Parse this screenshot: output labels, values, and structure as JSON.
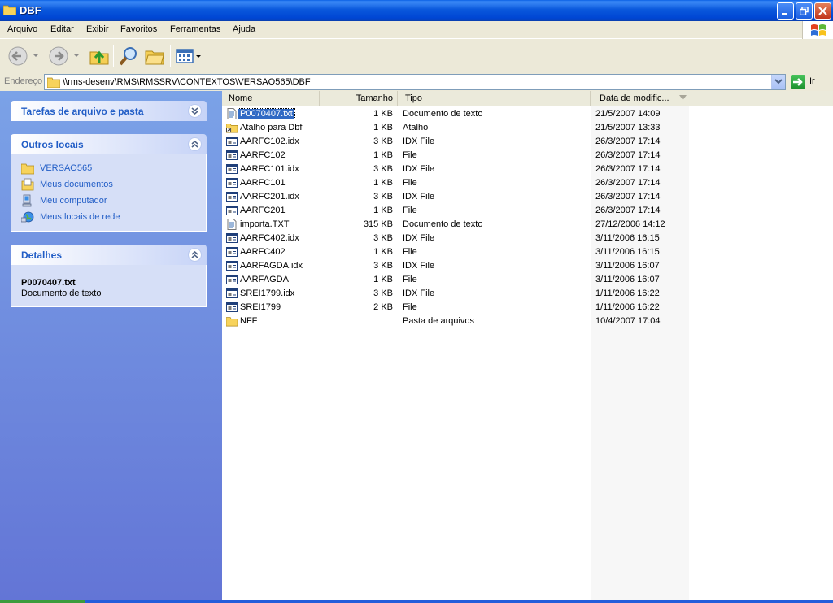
{
  "window": {
    "title": "DBF"
  },
  "menu": [
    "Arquivo",
    "Editar",
    "Exibir",
    "Favoritos",
    "Ferramentas",
    "Ajuda"
  ],
  "address": {
    "label": "Endereço",
    "path": "\\\\rms-desenv\\RMS\\RMSSRV\\CONTEXTOS\\VERSAO565\\DBF",
    "go_label": "Ir"
  },
  "taskpane": {
    "tasks_title": "Tarefas de arquivo e pasta",
    "places_title": "Outros locais",
    "places": [
      {
        "label": "VERSAO565",
        "icon": "folder-icon"
      },
      {
        "label": "Meus documentos",
        "icon": "my-documents-icon"
      },
      {
        "label": "Meu computador",
        "icon": "my-computer-icon"
      },
      {
        "label": "Meus locais de rede",
        "icon": "network-places-icon"
      }
    ],
    "details_title": "Detalhes",
    "details_name": "P0070407.txt",
    "details_type": "Documento de texto"
  },
  "columns": {
    "name": "Nome",
    "size": "Tamanho",
    "type": "Tipo",
    "date": "Data de modific..."
  },
  "files": [
    {
      "name": "P0070407.txt",
      "size": "1 KB",
      "type": "Documento de texto",
      "date": "21/5/2007 14:09",
      "icon": "text-file-icon",
      "selected": true
    },
    {
      "name": "Atalho para Dbf",
      "size": "1 KB",
      "type": "Atalho",
      "date": "21/5/2007 13:33",
      "icon": "shortcut-folder-icon"
    },
    {
      "name": "AARFC102.idx",
      "size": "3 KB",
      "type": "IDX File",
      "date": "26/3/2007 17:14",
      "icon": "file-icon"
    },
    {
      "name": "AARFC102",
      "size": "1 KB",
      "type": "File",
      "date": "26/3/2007 17:14",
      "icon": "file-icon"
    },
    {
      "name": "AARFC101.idx",
      "size": "3 KB",
      "type": "IDX File",
      "date": "26/3/2007 17:14",
      "icon": "file-icon"
    },
    {
      "name": "AARFC101",
      "size": "1 KB",
      "type": "File",
      "date": "26/3/2007 17:14",
      "icon": "file-icon"
    },
    {
      "name": "AARFC201.idx",
      "size": "3 KB",
      "type": "IDX File",
      "date": "26/3/2007 17:14",
      "icon": "file-icon"
    },
    {
      "name": "AARFC201",
      "size": "1 KB",
      "type": "File",
      "date": "26/3/2007 17:14",
      "icon": "file-icon"
    },
    {
      "name": "importa.TXT",
      "size": "315 KB",
      "type": "Documento de texto",
      "date": "27/12/2006 14:12",
      "icon": "text-file-icon"
    },
    {
      "name": "AARFC402.idx",
      "size": "3 KB",
      "type": "IDX File",
      "date": "3/11/2006 16:15",
      "icon": "file-icon"
    },
    {
      "name": "AARFC402",
      "size": "1 KB",
      "type": "File",
      "date": "3/11/2006 16:15",
      "icon": "file-icon"
    },
    {
      "name": "AARFAGDA.idx",
      "size": "3 KB",
      "type": "IDX File",
      "date": "3/11/2006 16:07",
      "icon": "file-icon"
    },
    {
      "name": "AARFAGDA",
      "size": "1 KB",
      "type": "File",
      "date": "3/11/2006 16:07",
      "icon": "file-icon"
    },
    {
      "name": "SREI1799.idx",
      "size": "3 KB",
      "type": "IDX File",
      "date": "1/11/2006 16:22",
      "icon": "file-icon"
    },
    {
      "name": "SREI1799",
      "size": "2 KB",
      "type": "File",
      "date": "1/11/2006 16:22",
      "icon": "file-icon"
    },
    {
      "name": "NFF",
      "size": "",
      "type": "Pasta de arquivos",
      "date": "10/4/2007 17:04",
      "icon": "folder-icon"
    }
  ]
}
